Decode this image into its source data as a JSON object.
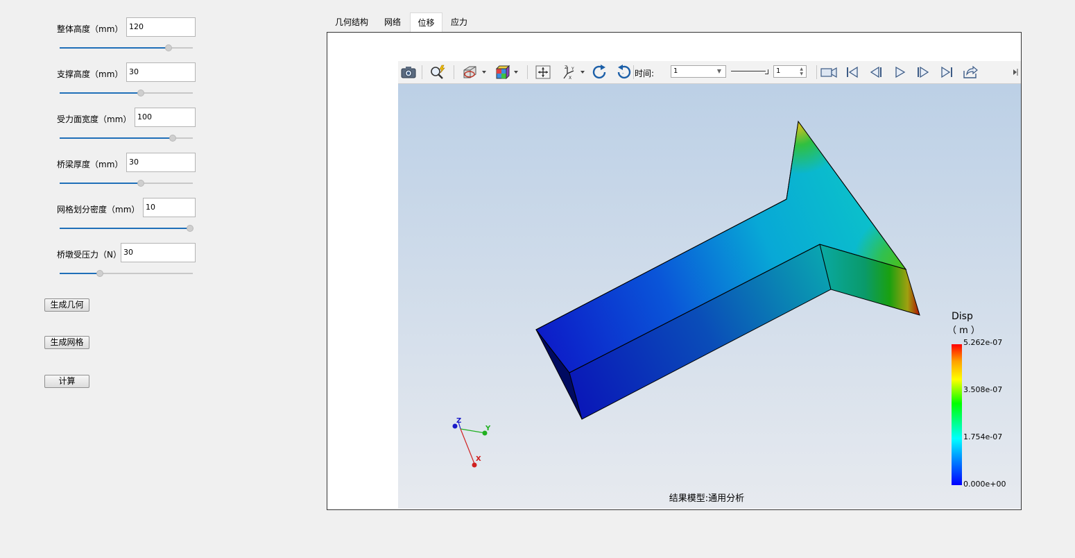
{
  "params": [
    {
      "label": "整体高度（mm）",
      "value": "120",
      "slider": 0.82
    },
    {
      "label": "支撑高度（mm）",
      "value": "30",
      "slider": 0.61
    },
    {
      "label": "受力面宽度（mm）",
      "value": "100",
      "slider": 0.85
    },
    {
      "label": "桥梁厚度（mm）",
      "value": "30",
      "slider": 0.61
    },
    {
      "label": "网格划分密度（mm）",
      "value": "10",
      "slider": 1.0
    },
    {
      "label": "桥墩受压力（N）",
      "value": "30",
      "slider": 0.3
    }
  ],
  "buttons": {
    "generate_geometry": "生成几何",
    "generate_mesh": "生成网格",
    "compute": "计算"
  },
  "tabs": [
    {
      "label": "几何结构",
      "active": false
    },
    {
      "label": "网络",
      "active": false
    },
    {
      "label": "位移",
      "active": true
    },
    {
      "label": "应力",
      "active": false
    }
  ],
  "toolbar": {
    "time_label": "时间:",
    "time_value": "1",
    "frame_value": "1"
  },
  "viewport": {
    "model_caption": "结果模型:通用分析",
    "axes": {
      "x": "X",
      "y": "Y",
      "z": "Z"
    }
  },
  "legend": {
    "title": "Disp",
    "unit": "（ m ）",
    "values": [
      "5.262e-07",
      "3.508e-07",
      "1.754e-07",
      "0.000e+00"
    ]
  },
  "colors": {
    "slider_fill": "#1f6fb8",
    "legend_top": "#ff0000",
    "legend_bottom": "#0000ff"
  }
}
